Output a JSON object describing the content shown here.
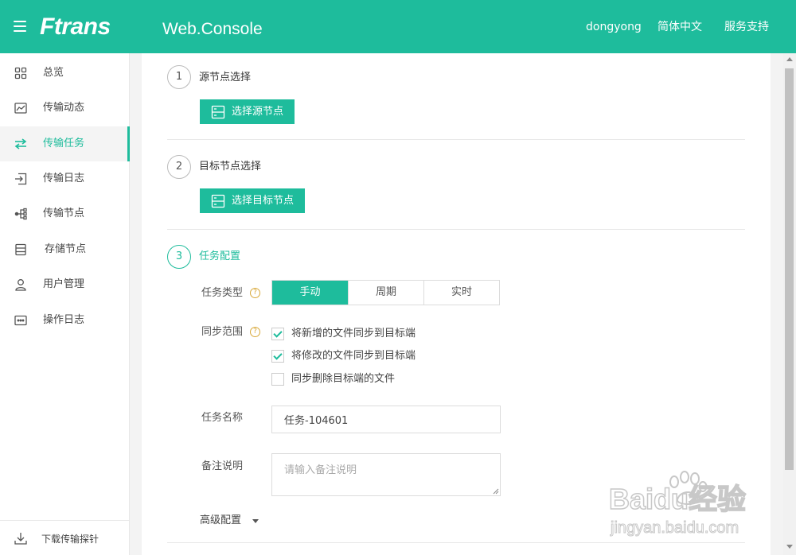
{
  "header": {
    "logo": "Ftrans",
    "subtitle": "Web.Console",
    "user": "dongyong",
    "language": "简体中文",
    "support": "服务支持"
  },
  "sidebar": {
    "items": [
      {
        "label": "总览",
        "icon": "grid-icon"
      },
      {
        "label": "传输动态",
        "icon": "chart-icon"
      },
      {
        "label": "传输任务",
        "icon": "transfer-arrows-icon"
      },
      {
        "label": "传输日志",
        "icon": "log-in-icon"
      },
      {
        "label": "传输节点",
        "icon": "node-tree-icon"
      },
      {
        "label": "存储节点",
        "icon": "storage-icon"
      },
      {
        "label": "用户管理",
        "icon": "user-icon"
      },
      {
        "label": "操作日志",
        "icon": "operation-log-icon"
      }
    ],
    "active_index": 2,
    "download_label": "下载传输探针"
  },
  "steps": [
    {
      "number": "1",
      "title": "源节点选择",
      "button": "选择源节点"
    },
    {
      "number": "2",
      "title": "目标节点选择",
      "button": "选择目标节点"
    },
    {
      "number": "3",
      "title": "任务配置"
    }
  ],
  "config": {
    "task_type_label": "任务类型",
    "task_types": [
      "手动",
      "周期",
      "实时"
    ],
    "task_type_selected": "手动",
    "sync_scope_label": "同步范围",
    "sync_options": [
      {
        "label": "将新增的文件同步到目标端",
        "checked": true
      },
      {
        "label": "将修改的文件同步到目标端",
        "checked": true
      },
      {
        "label": "同步删除目标端的文件",
        "checked": false
      }
    ],
    "task_name_label": "任务名称",
    "task_name_value": "任务-104601",
    "remark_label": "备注说明",
    "remark_placeholder": "请输入备注说明",
    "advanced_label": "高级配置"
  },
  "watermark": {
    "brand": "Baidu经验",
    "url": "jingyan.baidu.com"
  },
  "colors": {
    "accent": "#1ebc9c",
    "help": "#d9a93a"
  }
}
